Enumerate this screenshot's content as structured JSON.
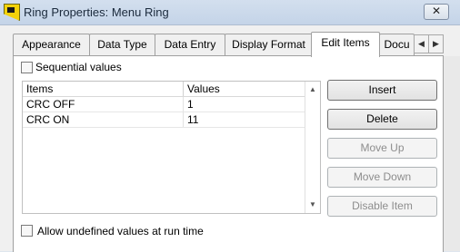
{
  "window": {
    "title": "Ring Properties: Menu Ring",
    "close_label": "✕"
  },
  "tabs": [
    {
      "label": "Appearance"
    },
    {
      "label": "Data Type"
    },
    {
      "label": "Data Entry"
    },
    {
      "label": "Display Format"
    },
    {
      "label": "Edit Items"
    },
    {
      "label": "Docu"
    }
  ],
  "active_tab": "Edit Items",
  "tab_scroll": {
    "left": "◀",
    "right": "▶"
  },
  "sequential_values": {
    "label": "Sequential values",
    "checked": false
  },
  "table": {
    "headers": [
      "Items",
      "Values"
    ],
    "rows": [
      {
        "item": "CRC OFF",
        "value": "1"
      },
      {
        "item": "CRC ON",
        "value": "11"
      }
    ],
    "scroll_up": "▲",
    "scroll_down": "▼"
  },
  "buttons": {
    "insert": "Insert",
    "delete": "Delete",
    "move_up": "Move Up",
    "move_down": "Move Down",
    "disable_item": "Disable Item"
  },
  "allow_undefined": {
    "label": "Allow undefined values at run time",
    "checked": false
  }
}
